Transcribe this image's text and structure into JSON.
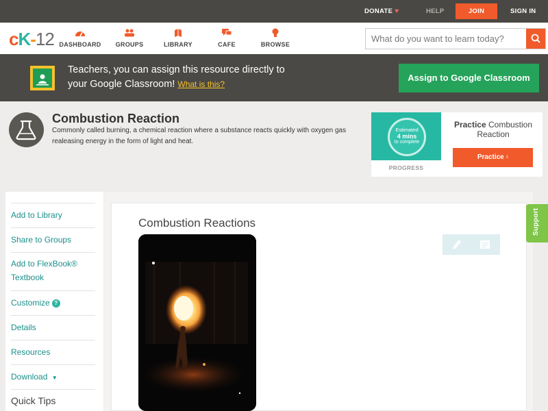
{
  "topbar": {
    "donate": "DONATE",
    "help": "HELP",
    "join": "JOIN",
    "signin": "SIGN IN"
  },
  "logo": {
    "c": "c",
    "k": "K",
    "dash": "-",
    "num": "12"
  },
  "nav": [
    {
      "label": "DASHBOARD",
      "icon": "dashboard-icon"
    },
    {
      "label": "GROUPS",
      "icon": "groups-icon"
    },
    {
      "label": "LIBRARY",
      "icon": "library-icon"
    },
    {
      "label": "CAFE",
      "icon": "cafe-icon"
    },
    {
      "label": "BROWSE",
      "icon": "browse-icon"
    }
  ],
  "search": {
    "placeholder": "What do you want to learn today?",
    "value": ""
  },
  "banner": {
    "line1": "Teachers, you can assign this resource directly to",
    "line2": "your Google Classroom!",
    "what": "What is this?",
    "button": "Assign to Google Classroom"
  },
  "concept": {
    "title": "Combustion Reaction",
    "description": "Commonly called burning, a chemical reaction where a substance reacts quickly with oxygen gas realeasing energy in the form of light and heat."
  },
  "practice": {
    "estimated": "Estimated",
    "mins": "4 mins",
    "complete": "to complete",
    "progress_label": "PROGRESS",
    "title_bold": "Practice",
    "title_rest": "Combustion Reaction",
    "button": "Practice"
  },
  "sidebar": {
    "items": [
      {
        "label": "Add to Library"
      },
      {
        "label": "Share to Groups"
      },
      {
        "label": "Add to FlexBook®",
        "label2": "Textbook"
      },
      {
        "label": "Customize"
      },
      {
        "label": "Details"
      },
      {
        "label": "Resources"
      },
      {
        "label": "Download"
      }
    ],
    "quick_tips": "Quick Tips"
  },
  "main": {
    "title": "Combustion Reactions"
  },
  "support": "Support",
  "colors": {
    "accent": "#f15a2b",
    "teal": "#2fb5a1",
    "classroom_green": "#25a35a",
    "support_green": "#7ec548"
  }
}
